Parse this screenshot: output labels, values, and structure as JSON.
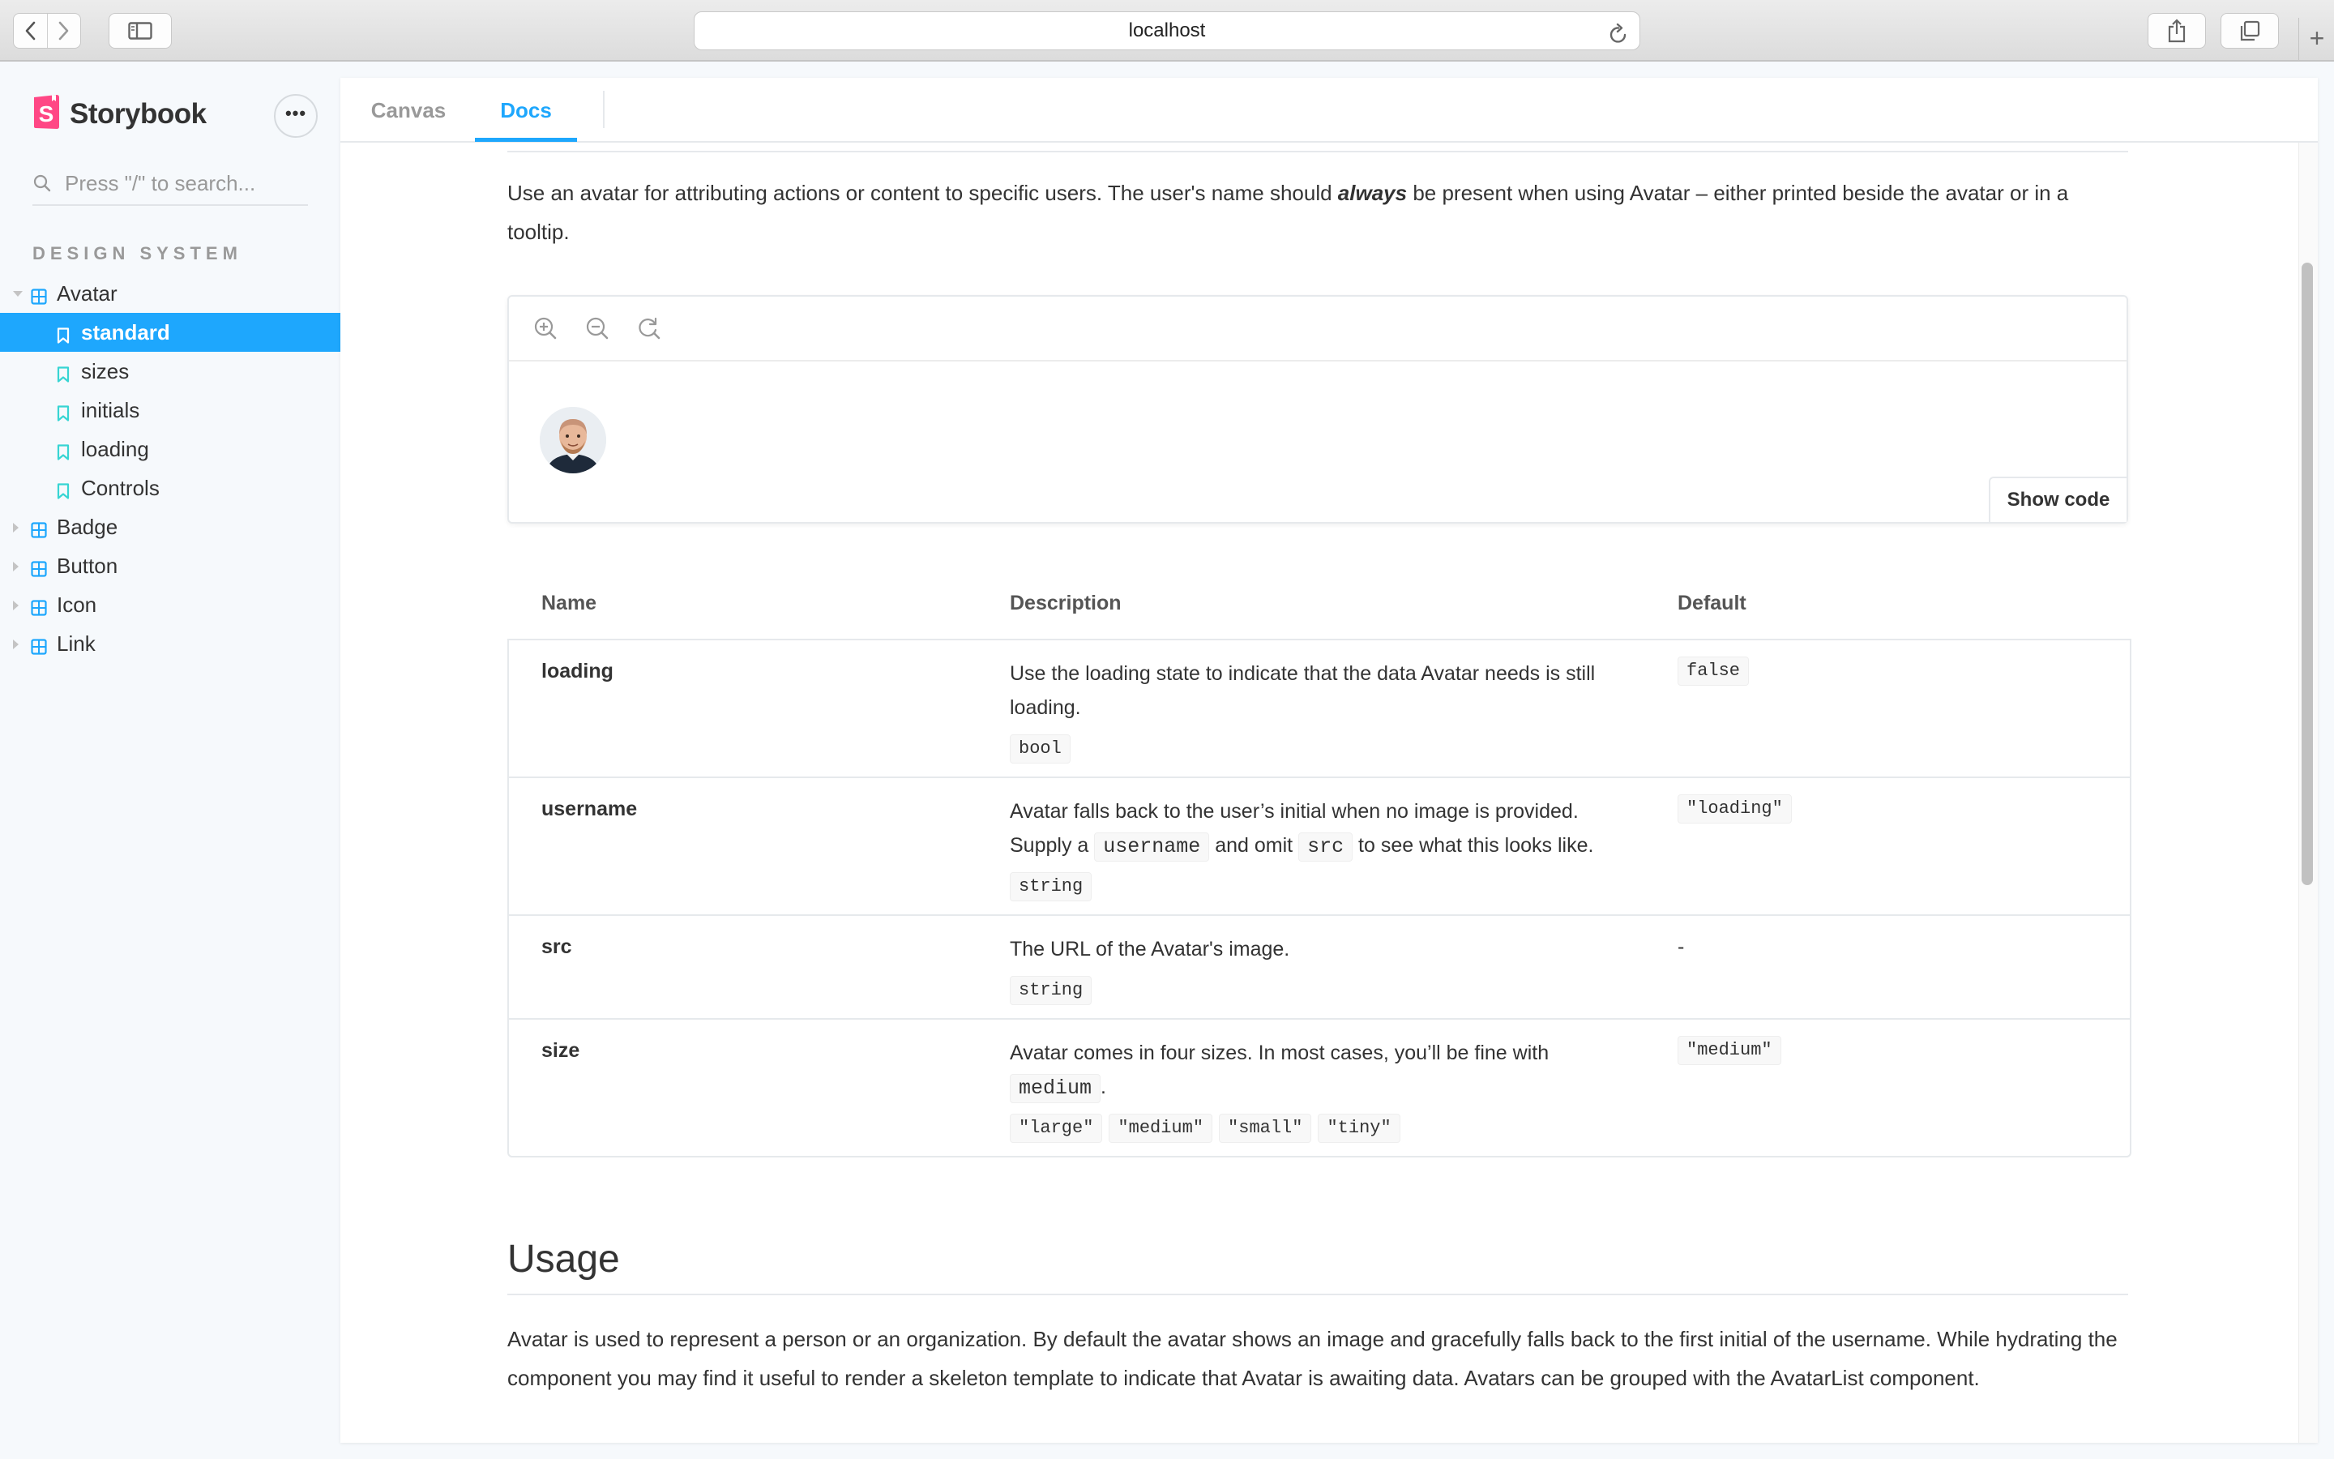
{
  "browser": {
    "url": "localhost",
    "new_tab_label": "+"
  },
  "sidebar": {
    "brand_name": "Storybook",
    "menu_label": "•••",
    "search_placeholder": "Press \"/\" to search...",
    "section_title": "DESIGN SYSTEM",
    "components": [
      {
        "label": "Avatar",
        "expanded": true,
        "stories": [
          {
            "label": "standard",
            "selected": true
          },
          {
            "label": "sizes"
          },
          {
            "label": "initials"
          },
          {
            "label": "loading"
          },
          {
            "label": "Controls"
          }
        ]
      },
      {
        "label": "Badge"
      },
      {
        "label": "Button"
      },
      {
        "label": "Icon"
      },
      {
        "label": "Link"
      }
    ]
  },
  "tabs": {
    "canvas": "Canvas",
    "docs": "Docs",
    "active": "docs"
  },
  "docs": {
    "intro_before": "Use an avatar for attributing actions or content to specific users. The user's name should ",
    "intro_emphasis": "always",
    "intro_after": " be present when using Avatar – either printed beside the avatar or in a tooltip.",
    "preview": {
      "show_code_label": "Show code",
      "toolbar_icons": [
        "zoom-in-icon",
        "zoom-out-icon",
        "zoom-reset-icon"
      ]
    },
    "props_table": {
      "headers": {
        "name": "Name",
        "description": "Description",
        "default": "Default"
      },
      "rows": {
        "loading": {
          "name": "loading",
          "desc": "Use the loading state to indicate that the data Avatar needs is still loading.",
          "type": "bool",
          "default": "false"
        },
        "username": {
          "name": "username",
          "desc_1": "Avatar falls back to the user’s initial when no image is provided. Supply a ",
          "desc_code_1": "username",
          "desc_2": " and omit ",
          "desc_code_2": "src",
          "desc_3": " to see what this looks like.",
          "type": "string",
          "default": "\"loading\""
        },
        "src": {
          "name": "src",
          "desc": "The URL of the Avatar's image.",
          "type": "string",
          "default": "-"
        },
        "size": {
          "name": "size",
          "desc_1": "Avatar comes in four sizes. In most cases, you’ll be fine with ",
          "desc_code_1": "medium",
          "desc_2": ".",
          "types": [
            "\"large\"",
            "\"medium\"",
            "\"small\"",
            "\"tiny\""
          ],
          "default": "\"medium\""
        }
      }
    },
    "usage": {
      "title": "Usage",
      "text": "Avatar is used to represent a person or an organization. By default the avatar shows an image and gracefully falls back to the first initial of the username. While hydrating the component you may find it useful to render a skeleton template to indicate that Avatar is awaiting data. Avatars can be grouped with the AvatarList component."
    }
  },
  "colors": {
    "accent": "#1ea7fd",
    "brand": "#ff4785",
    "story_icon": "#37d5d3"
  }
}
